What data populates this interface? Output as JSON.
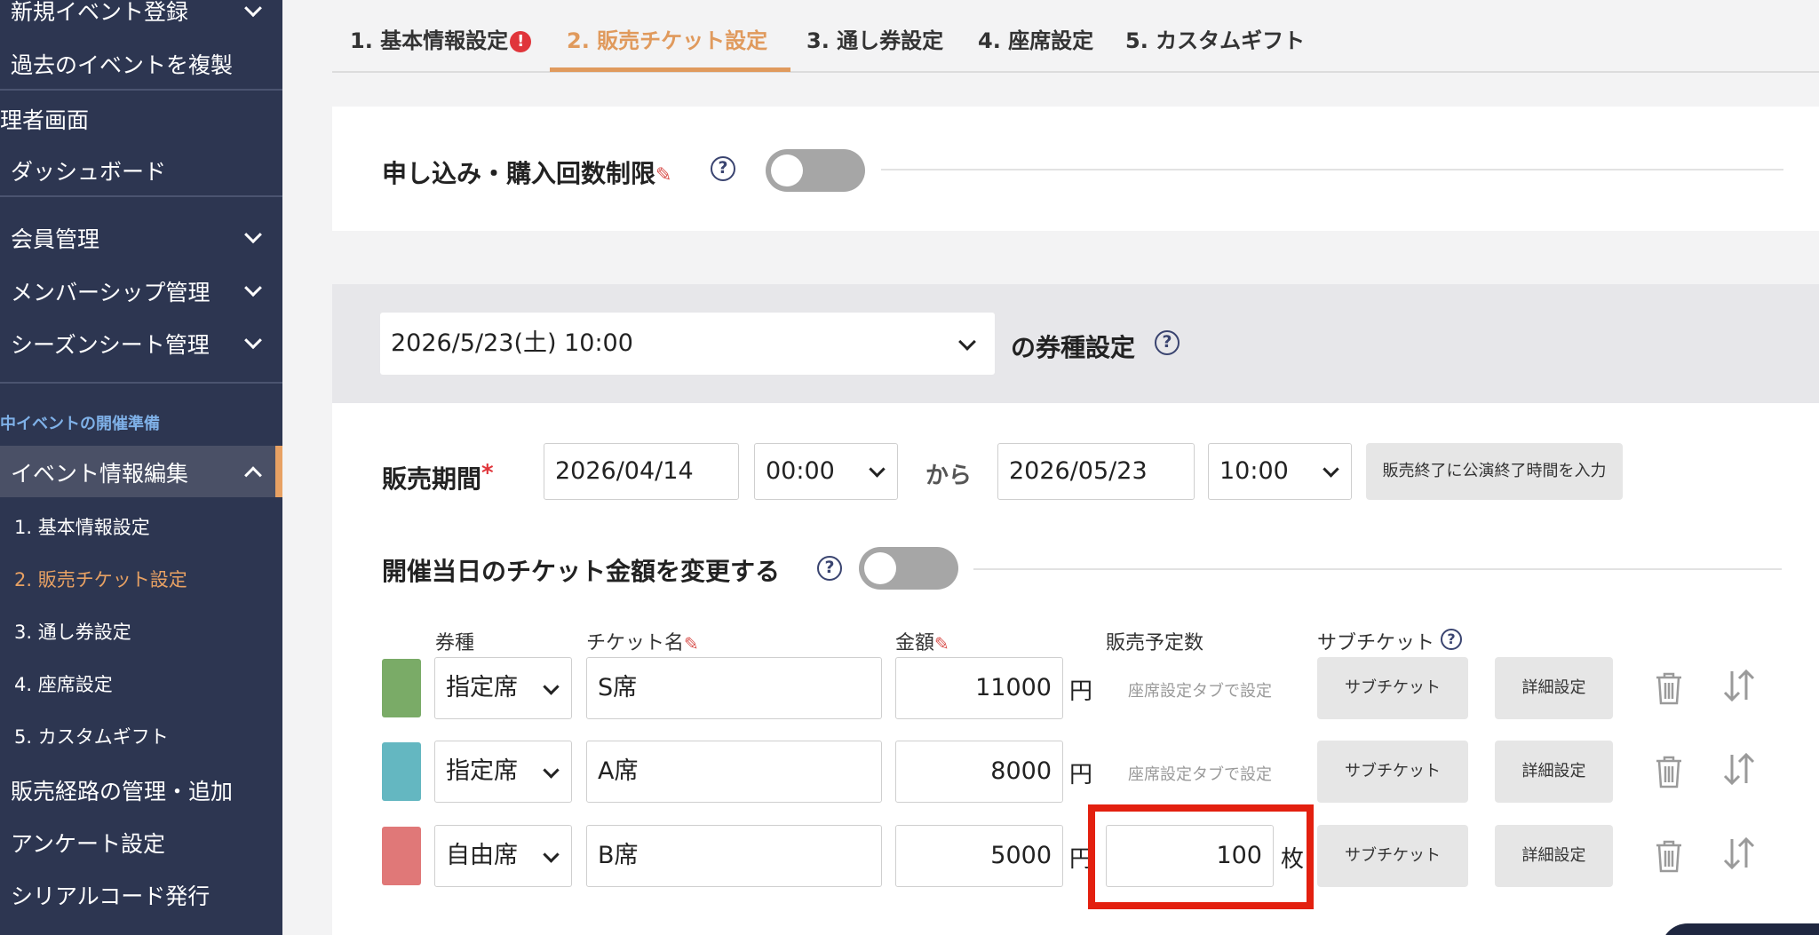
{
  "sidebar": {
    "top_items": [
      {
        "label": "新規イベント登録"
      },
      {
        "label": "過去のイベントを複製"
      }
    ],
    "admin_header": "理者画面",
    "dashboard": "ダッシュボード",
    "management": [
      {
        "label": "会員管理"
      },
      {
        "label": "メンバーシップ管理"
      },
      {
        "label": "シーズンシート管理"
      }
    ],
    "section_label": "中イベントの開催準備",
    "event_edit": "イベント情報編集",
    "sub_items": [
      {
        "label": "1. 基本情報設定"
      },
      {
        "label": "2. 販売チケット設定"
      },
      {
        "label": "3. 通し券設定"
      },
      {
        "label": "4. 座席設定"
      },
      {
        "label": "5. カスタムギフト"
      }
    ],
    "bottom_items": [
      {
        "label": "販売経路の管理・追加"
      },
      {
        "label": "アンケート設定"
      },
      {
        "label": "シリアルコード発行"
      }
    ]
  },
  "tabs": [
    {
      "label": "1. 基本情報設定",
      "alert": "!"
    },
    {
      "label": "2. 販売チケット設定"
    },
    {
      "label": "3. 通し券設定"
    },
    {
      "label": "4. 座席設定"
    },
    {
      "label": "5. カスタムギフト"
    }
  ],
  "purchase_limit": {
    "title": "申し込み・購入回数制限",
    "toggle": "off"
  },
  "ticket_type": {
    "date_value": "2026/5/23(土) 10:00",
    "suffix": "の券種設定"
  },
  "sales_period": {
    "label": "販売期間",
    "required_mark": "*",
    "start_date": "2026/04/14",
    "start_time": "00:00",
    "from": "から",
    "end_date": "2026/05/23",
    "end_time": "10:00",
    "button": "販売終了に公演終了時間を入力"
  },
  "day_price": {
    "title": "開催当日のチケット金額を変更する",
    "toggle": "off"
  },
  "table": {
    "headers": {
      "kind": "券種",
      "name": "チケット名",
      "price": "金額",
      "quantity": "販売予定数",
      "sub": "サブチケット"
    },
    "rows": [
      {
        "color": "#7aab67",
        "kind": "指定席",
        "name": "S席",
        "price": "11000",
        "currency": "円",
        "quantity_note": "座席設定タブで設定",
        "sub_button": "サブチケット",
        "detail_button": "詳細設定"
      },
      {
        "color": "#64b7c1",
        "kind": "指定席",
        "name": "A席",
        "price": "8000",
        "currency": "円",
        "quantity_note": "座席設定タブで設定",
        "sub_button": "サブチケット",
        "detail_button": "詳細設定"
      },
      {
        "color": "#e07878",
        "kind": "自由席",
        "name": "B席",
        "price": "5000",
        "currency": "円",
        "quantity": "100",
        "quantity_unit": "枚",
        "sub_button": "サブチケット",
        "detail_button": "詳細設定"
      }
    ]
  },
  "colors": {
    "accent": "#e09a5d",
    "sidebar_bg": "#2d3651",
    "highlight": "#e3200f"
  }
}
